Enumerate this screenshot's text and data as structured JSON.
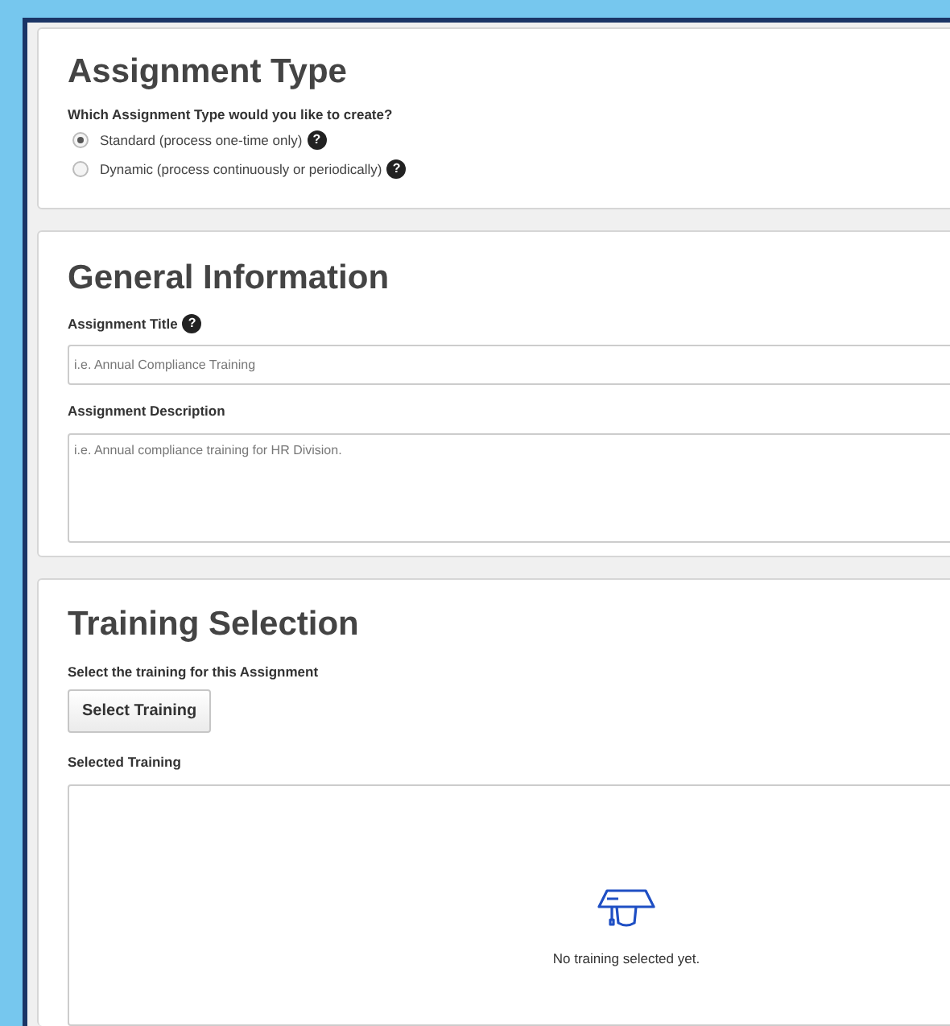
{
  "assignment_type": {
    "title": "Assignment Type",
    "question": "Which Assignment Type would you like to create?",
    "options": [
      {
        "label": "Standard (process one-time only)",
        "selected": true,
        "help": "?"
      },
      {
        "label": "Dynamic (process continuously or periodically)",
        "selected": false,
        "help": "?"
      }
    ]
  },
  "general_information": {
    "title": "General Information",
    "title_field": {
      "label": "Assignment Title",
      "help": "?",
      "placeholder": "i.e. Annual Compliance Training"
    },
    "description_field": {
      "label": "Assignment Description",
      "placeholder": "i.e. Annual compliance training for HR Division."
    }
  },
  "training_selection": {
    "title": "Training Selection",
    "prompt": "Select the training for this Assignment",
    "button": "Select Training",
    "selected_label": "Selected Training",
    "empty_message": "No training selected yet."
  }
}
